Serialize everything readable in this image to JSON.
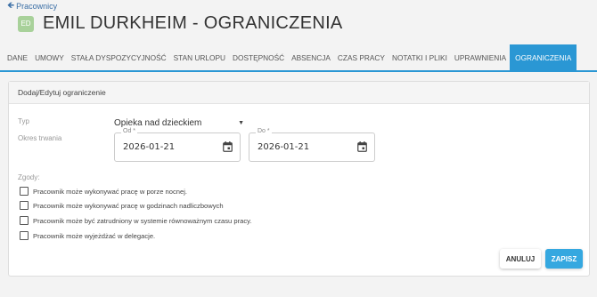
{
  "back_link": {
    "label": "Pracownicy"
  },
  "header": {
    "avatar_initials": "ED",
    "title": "EMIL DURKHEIM - OGRANICZENIA"
  },
  "tabs": [
    {
      "label": "DANE",
      "active": false
    },
    {
      "label": "UMOWY",
      "active": false
    },
    {
      "label": "STAŁA DYSPOZYCYJNOŚĆ",
      "active": false
    },
    {
      "label": "STAN URLOPU",
      "active": false
    },
    {
      "label": "DOSTĘPNOŚĆ",
      "active": false
    },
    {
      "label": "ABSENCJA",
      "active": false
    },
    {
      "label": "CZAS PRACY",
      "active": false
    },
    {
      "label": "NOTATKI I PLIKI",
      "active": false
    },
    {
      "label": "UPRAWNIENIA",
      "active": false
    },
    {
      "label": "OGRANICZENIA",
      "active": true
    }
  ],
  "form": {
    "header": "Dodaj/Edytuj ograniczenie",
    "type_label": "Typ",
    "type_value": "Opieka nad dzieckiem",
    "duration_label": "Okres trwania",
    "from_label": "Od *",
    "from_value": "2026-01-21",
    "to_label": "Do *",
    "to_value": "2026-01-21",
    "consents_label": "Zgody:",
    "consents": [
      "Pracownik może wykonywać pracę w porze nocnej.",
      "Pracownik może wykonywać pracę w godzinach nadliczbowych",
      "Pracownik może być zatrudniony w systemie równoważnym czasu pracy.",
      "Pracownik może wyjeżdżać w delegacje."
    ]
  },
  "buttons": {
    "cancel": "ANULUJ",
    "save": "ZAPISZ"
  },
  "colors": {
    "accent": "#2a97d4",
    "avatar": "#a8d19a",
    "save_button": "#35a8e0"
  }
}
